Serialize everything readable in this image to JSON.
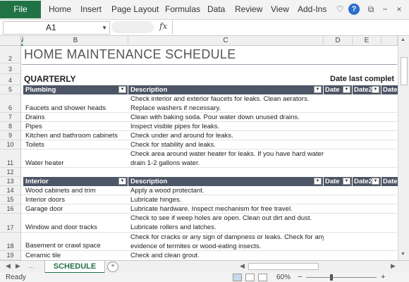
{
  "ribbon": {
    "file_label": "File",
    "tabs": [
      "Home",
      "Insert",
      "Page Layout",
      "Formulas",
      "Data",
      "Review",
      "View",
      "Add-Ins"
    ],
    "icons": [
      "heart-icon",
      "help-icon",
      "restore-icon",
      "minimize-icon",
      "maximize-icon",
      "close-icon"
    ],
    "help_label": "?"
  },
  "formula_bar": {
    "name_box": "A1",
    "fx_label": "fx",
    "value": ""
  },
  "columns": [
    "A",
    "B",
    "C",
    "D",
    "E"
  ],
  "rows": [
    "2",
    "3",
    "4",
    "5",
    "6",
    "7",
    "8",
    "9",
    "10",
    "11",
    "12",
    "13",
    "14",
    "15",
    "16",
    "17",
    "18",
    "19"
  ],
  "sheet": {
    "title": "HOME MAINTENANCE SCHEDULE",
    "section": "QUARTERLY",
    "date_last": "Date last complet",
    "plumbing": {
      "headers": [
        "Plumbing",
        "Description",
        "Date",
        "Date2",
        "Date"
      ],
      "items": [
        {
          "name": "Faucets and shower heads",
          "desc": [
            "Check interior and exterior faucets for leaks. Clean aerators.",
            "Replace washers if necessary."
          ]
        },
        {
          "name": "Drains",
          "desc": [
            "Clean with baking soda. Pour water down unused drains."
          ]
        },
        {
          "name": "Pipes",
          "desc": [
            "Inspect visible pipes for leaks."
          ]
        },
        {
          "name": "Kitchen and bathroom cabinets",
          "desc": [
            "Check under and around for leaks."
          ]
        },
        {
          "name": "Toilets",
          "desc": [
            "Check for stability and leaks."
          ]
        },
        {
          "name": "Water heater",
          "desc": [
            "Check area around water heater for leaks. If you have hard water,",
            "drain 1-2 gallons water."
          ]
        }
      ]
    },
    "interior": {
      "headers": [
        "Interior",
        "Description",
        "Date",
        "Date2",
        "Date"
      ],
      "items": [
        {
          "name": "Wood cabinets and trim",
          "desc": [
            "Apply a wood protectant."
          ]
        },
        {
          "name": "Interior doors",
          "desc": [
            "Lubricate hinges."
          ]
        },
        {
          "name": "Garage door",
          "desc": [
            "Lubricate hardware. Inspect mechanism for free travel."
          ]
        },
        {
          "name": "Window and door tracks",
          "desc": [
            "Check to see if weep holes are open. Clean out dirt and dust.",
            "Lubricate rollers and latches."
          ]
        },
        {
          "name": "Basement or crawl space",
          "desc": [
            "Check for cracks or any sign of dampness or leaks. Check for any",
            "evidence of termites or wood-eating insects."
          ]
        },
        {
          "name": "Ceramic tile",
          "desc": [
            "Check and clean grout."
          ]
        }
      ]
    }
  },
  "sheet_tabs": {
    "active": "SCHEDULE",
    "new_sheet": "+"
  },
  "status": {
    "ready": "Ready",
    "zoom": "60%",
    "minus": "−",
    "plus": "+"
  }
}
